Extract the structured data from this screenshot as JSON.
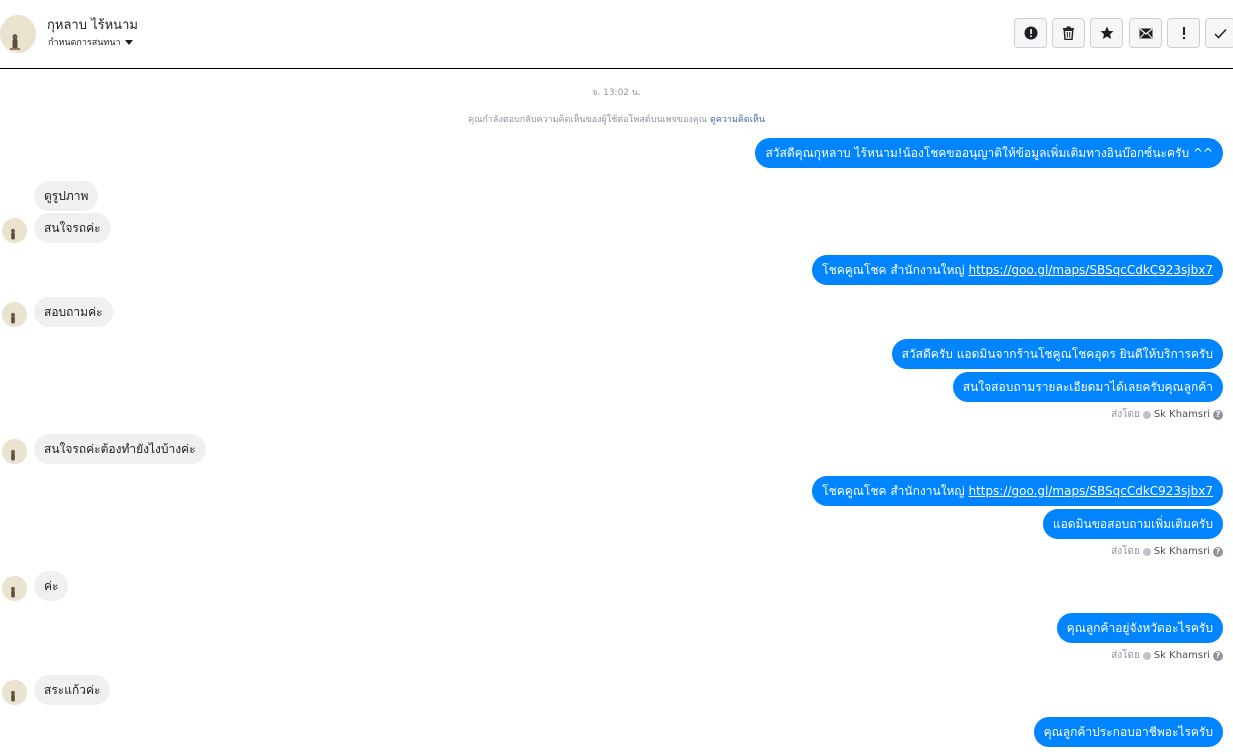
{
  "header": {
    "contact_name": "กุหลาบ ไร้หนาม",
    "assign_label": "กำหนดการสนทนา"
  },
  "toolbar": [
    {
      "icon": "alert-circle-icon"
    },
    {
      "icon": "trash-icon"
    },
    {
      "icon": "star-icon"
    },
    {
      "icon": "envelope-icon"
    },
    {
      "icon": "exclamation-icon"
    },
    {
      "icon": "check-icon"
    }
  ],
  "thread": {
    "timestamp": "จ. 13:02 น.",
    "notice_text": "คุณกำลังตอบกลับความคิดเห็นของผู้ใช้ต่อโพสต์บนเพจของคุณ",
    "notice_link": "ดูความคิดเห็น",
    "sent_by_label": "ส่งโดย",
    "sent_by_name": "Sk Khamsri"
  },
  "messages": [
    {
      "side": "out",
      "text": "สวัสดีคุณกุหลาบ ไร้หนาม!น้องโชคขออนุญาติให้ข้อมูลเพิ่มเติมทางอินบ๊อกซ์นะครับ ^^"
    },
    {
      "side": "in",
      "text": "ดูรูปภาพ"
    },
    {
      "side": "in",
      "text": "สนใจรถค่ะ"
    },
    {
      "side": "out",
      "text": "โชคคูณโชค สำนักงานใหญ่ ",
      "link": "https://goo.gl/maps/SBSqcCdkC923sjbx7"
    },
    {
      "side": "in",
      "text": "สอบถามค่ะ"
    },
    {
      "side": "out",
      "text": "สวัสดีครับ แอดมินจากร้านโชคูณโชคอุดร ยินดีให้บริการครับ"
    },
    {
      "side": "out",
      "text": "สนใจสอบถามรายละเอียดมาได้เลยครับคุณลูกค้า"
    },
    {
      "side": "in",
      "text": "สนใจรถค่ะต้องทำยังไงบ้างค่ะ"
    },
    {
      "side": "out",
      "text": "โชคคูณโชค สำนักงานใหญ่ ",
      "link": "https://goo.gl/maps/SBSqcCdkC923sjbx7"
    },
    {
      "side": "out",
      "text": "แอดมินขอสอบถามเพิ่มเติมครับ"
    },
    {
      "side": "in",
      "text": "ค่ะ"
    },
    {
      "side": "out",
      "text": "คุณลูกค้าอยู่จังหวัดอะไรครับ"
    },
    {
      "side": "in",
      "text": "สระแก้วค่ะ"
    },
    {
      "side": "out",
      "text": "คุณลูกค้าประกอบอาชีพอะไรครับ"
    }
  ],
  "colors": {
    "outgoing_bubble": "#0084ff",
    "incoming_bubble": "#f1f0f0",
    "link": "#4267b2"
  }
}
